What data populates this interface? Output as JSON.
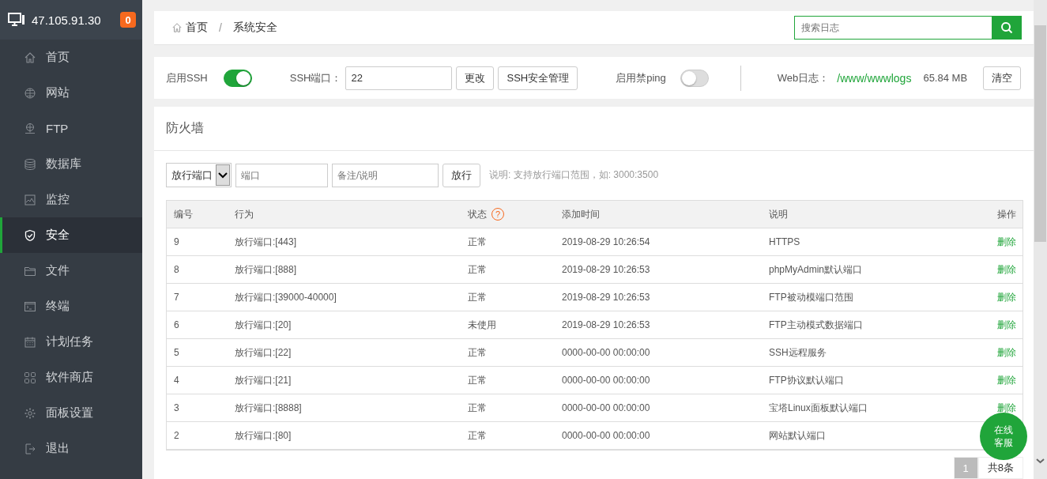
{
  "server": {
    "ip": "47.105.91.30",
    "badge": "0"
  },
  "sidebar": {
    "items": [
      {
        "label": "首页",
        "selected": false
      },
      {
        "label": "网站",
        "selected": false
      },
      {
        "label": "FTP",
        "selected": false
      },
      {
        "label": "数据库",
        "selected": false
      },
      {
        "label": "监控",
        "selected": false
      },
      {
        "label": "安全",
        "selected": true
      },
      {
        "label": "文件",
        "selected": false
      },
      {
        "label": "终端",
        "selected": false
      },
      {
        "label": "计划任务",
        "selected": false
      },
      {
        "label": "软件商店",
        "selected": false
      },
      {
        "label": "面板设置",
        "selected": false
      },
      {
        "label": "退出",
        "selected": false
      }
    ]
  },
  "breadcrumb": {
    "items": [
      "首页",
      "系统安全"
    ],
    "separator": "/"
  },
  "search": {
    "placeholder": "搜索日志"
  },
  "settings": {
    "ssh_label": "启用SSH",
    "ssh_on": true,
    "port_label": "SSH端口：",
    "port_value": "22",
    "change_button": "更改",
    "manage_button": "SSH安全管理",
    "ping_label": "启用禁ping",
    "ping_on": false,
    "weblog_label": "Web日志：",
    "weblog_path": "/www/wwwlogs",
    "weblog_size": "65.84 MB",
    "clear_button": "清空"
  },
  "firewall": {
    "title": "防火墙",
    "select_value": "放行端口",
    "port_placeholder": "端口",
    "note_placeholder": "备注/说明",
    "submit_button": "放行",
    "hint": "说明: 支持放行端口范围，如: 3000:3500",
    "table": {
      "columns": [
        "编号",
        "行为",
        "状态",
        "添加时间",
        "说明",
        "操作"
      ],
      "help_icon": "?",
      "rows": [
        [
          "9",
          "放行端口:[443]",
          "正常",
          "2019-08-29 10:26:54",
          "HTTPS",
          "删除"
        ],
        [
          "8",
          "放行端口:[888]",
          "正常",
          "2019-08-29 10:26:53",
          "phpMyAdmin默认端口",
          "删除"
        ],
        [
          "7",
          "放行端口:[39000-40000]",
          "正常",
          "2019-08-29 10:26:53",
          "FTP被动模端口范围",
          "删除"
        ],
        [
          "6",
          "放行端口:[20]",
          "未使用",
          "2019-08-29 10:26:53",
          "FTP主动模式数据端口",
          "删除"
        ],
        [
          "5",
          "放行端口:[22]",
          "正常",
          "0000-00-00 00:00:00",
          "SSH远程服务",
          "删除"
        ],
        [
          "4",
          "放行端口:[21]",
          "正常",
          "0000-00-00 00:00:00",
          "FTP协议默认端口",
          "删除"
        ],
        [
          "3",
          "放行端口:[8888]",
          "正常",
          "0000-00-00 00:00:00",
          "宝塔Linux面板默认端口",
          "删除"
        ],
        [
          "2",
          "放行端口:[80]",
          "正常",
          "0000-00-00 00:00:00",
          "网站默认端口"
        ]
      ]
    },
    "pagination": {
      "current": "1",
      "total": "共8条"
    }
  },
  "chat_button": [
    "在线",
    "客服"
  ]
}
